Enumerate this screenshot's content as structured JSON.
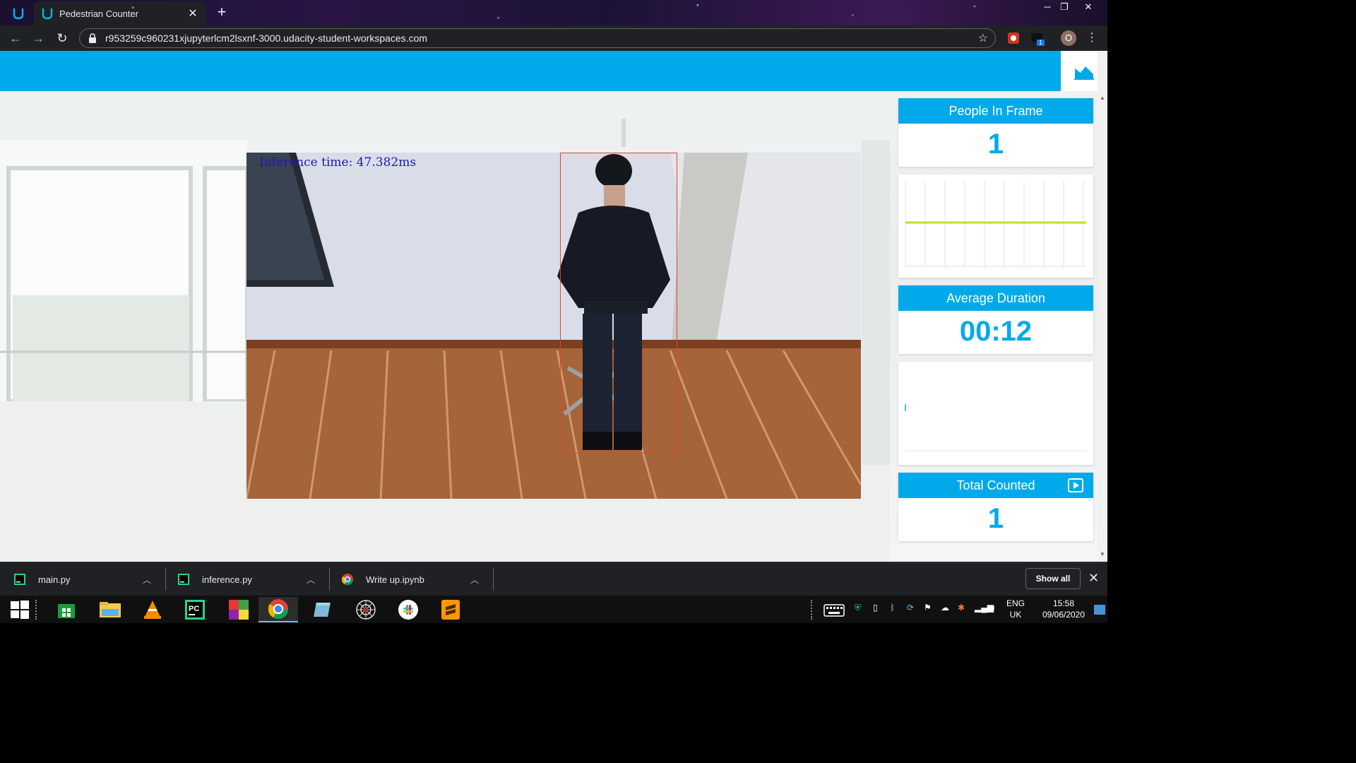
{
  "browser": {
    "tab_title": "Pedestrian Counter",
    "url": "r953259c960231xjupyterlcm2lsxnf-3000.udacity-student-workspaces.com",
    "profile_initial": "O",
    "extension_badge": "1"
  },
  "app": {
    "inference_text": "Inference time: 47.382ms",
    "people_in_frame": {
      "title": "People In Frame",
      "value": "1"
    },
    "average_duration": {
      "title": "Average Duration",
      "value": "00:12"
    },
    "total_counted": {
      "title": "Total Counted",
      "value": "1"
    }
  },
  "downloads": {
    "items": [
      {
        "name": "main.py",
        "icon": "pycharm-file-icon"
      },
      {
        "name": "inference.py",
        "icon": "pycharm-file-icon"
      },
      {
        "name": "Write up.ipynb",
        "icon": "chrome-file-icon"
      }
    ],
    "show_all_label": "Show all"
  },
  "taskbar": {
    "lang_line1": "ENG",
    "lang_line2": "UK",
    "time": "15:58",
    "date": "09/06/2020"
  },
  "colors": {
    "accent": "#00aaea",
    "bbox": "#e2452b",
    "chart_line": "#c8dc28",
    "inference_text": "#1a1ab0"
  }
}
